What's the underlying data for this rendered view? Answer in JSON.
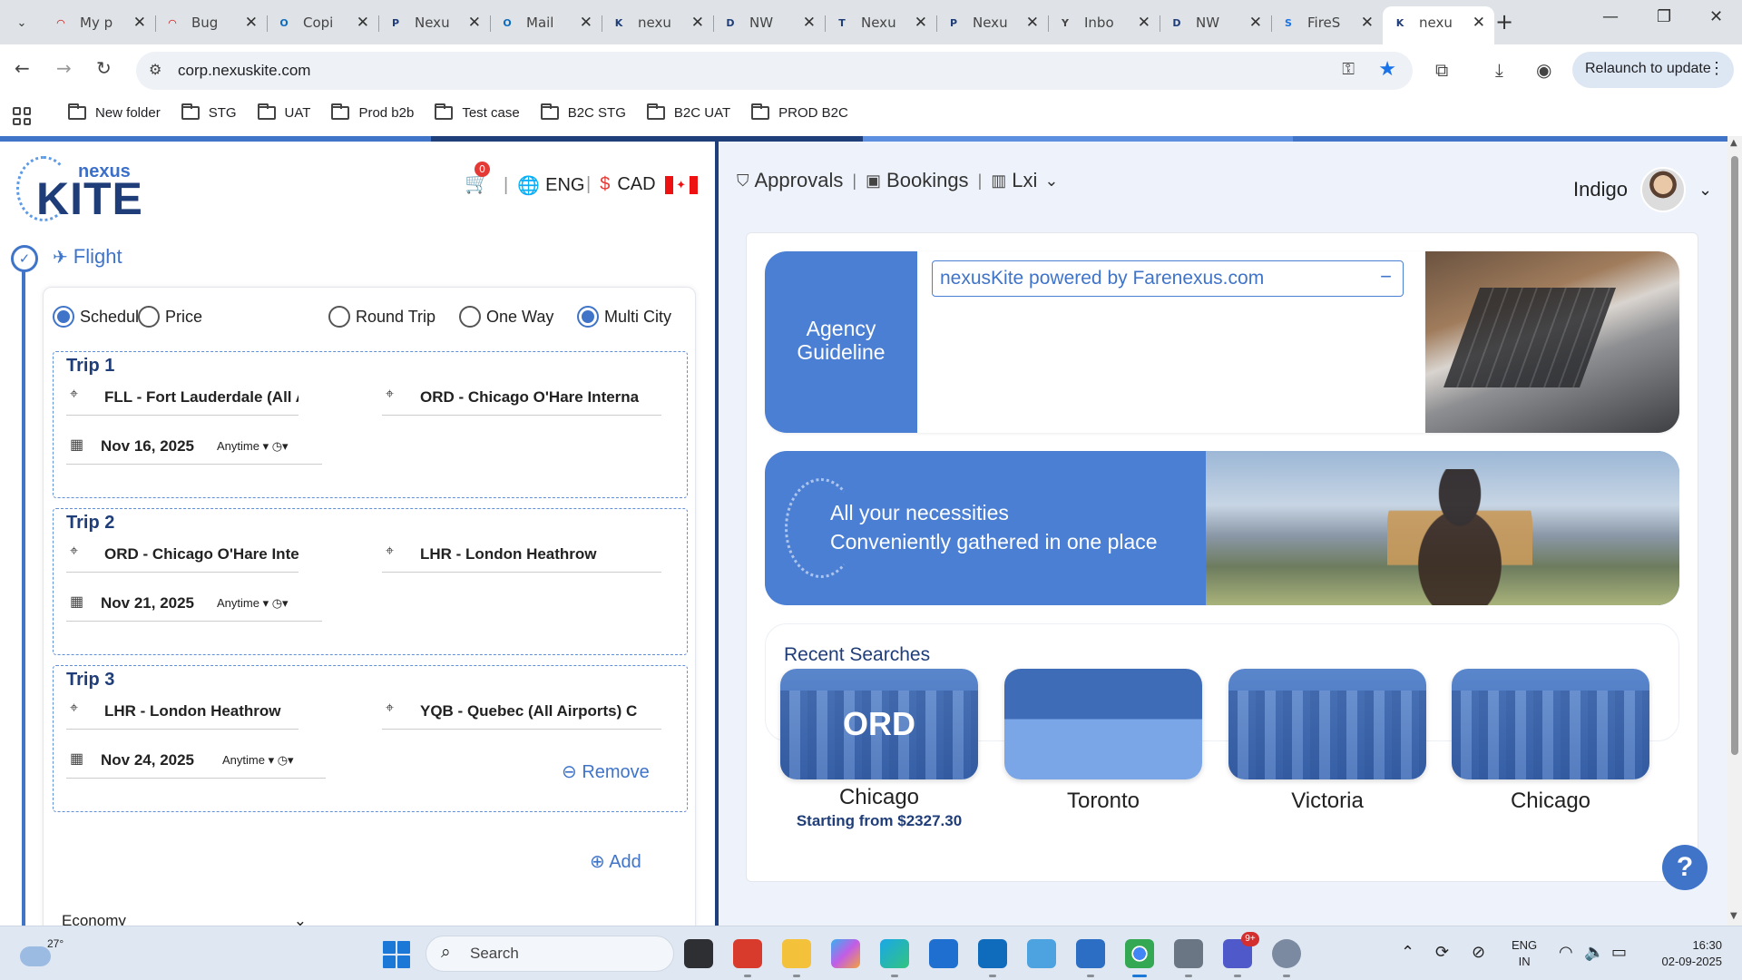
{
  "browser": {
    "tabs": [
      {
        "title": "My p",
        "icon": "redhat-icon",
        "color": "#cc0000",
        "glyph": "◠"
      },
      {
        "title": "Bug",
        "icon": "redhat-icon",
        "color": "#cc0000",
        "glyph": "◠"
      },
      {
        "title": "Copi",
        "icon": "outlook-icon",
        "color": "#0f6cbd",
        "glyph": "O"
      },
      {
        "title": "Nexu",
        "icon": "p-icon",
        "color": "#1f3d78",
        "glyph": "P"
      },
      {
        "title": "Mail",
        "icon": "outlook-icon",
        "color": "#0f6cbd",
        "glyph": "O"
      },
      {
        "title": "nexu",
        "icon": "k-icon",
        "color": "#1f3d78",
        "glyph": "K"
      },
      {
        "title": "NW",
        "icon": "d-icon",
        "color": "#1f3d78",
        "glyph": "D"
      },
      {
        "title": "Nexu",
        "icon": "t-icon",
        "color": "#1f3d78",
        "glyph": "T"
      },
      {
        "title": "Nexu",
        "icon": "p-icon",
        "color": "#1f3d78",
        "glyph": "P"
      },
      {
        "title": "Inbo",
        "icon": "yahoo-icon",
        "color": "#444444",
        "glyph": "Y"
      },
      {
        "title": "NW",
        "icon": "d-icon",
        "color": "#1f3d78",
        "glyph": "D"
      },
      {
        "title": "FireS",
        "icon": "fires-icon",
        "color": "#1a73e8",
        "glyph": "S"
      },
      {
        "title": "nexu",
        "icon": "k-icon",
        "color": "#1f3d78",
        "glyph": "K",
        "active": true
      }
    ],
    "url": "corp.nexuskite.com",
    "relaunch": "Relaunch to update",
    "bookmarks": [
      "New folder",
      "STG",
      "UAT",
      "Prod b2b",
      "Test case",
      "B2C STG",
      "B2C UAT",
      "PROD B2C"
    ]
  },
  "header": {
    "logo_top": "nexus",
    "logo_main": "KITE",
    "cart_count": "0",
    "language": "ENG",
    "currency": "CAD",
    "currency_symbol": "$"
  },
  "search": {
    "section": "Flight",
    "mode_options": [
      "Schedule",
      "Price"
    ],
    "mode_selected": "Schedule",
    "trip_types": [
      "Round Trip",
      "One Way",
      "Multi City"
    ],
    "trip_type_selected": "Multi City",
    "trips": [
      {
        "title": "Trip 1",
        "from": "FLL - Fort Lauderdale (All Airp",
        "to": "ORD - Chicago O'Hare Interna",
        "date": "Nov 16, 2025",
        "time": "Anytime"
      },
      {
        "title": "Trip 2",
        "from": "ORD - Chicago O'Hare Interna",
        "to": "LHR - London Heathrow",
        "date": "Nov 21, 2025",
        "time": "Anytime"
      },
      {
        "title": "Trip 3",
        "from": "LHR - London Heathrow",
        "to": "YQB - Quebec (All Airports) C",
        "date": "Nov 24, 2025",
        "time": "Anytime"
      }
    ],
    "remove_label": "Remove",
    "add_label": "Add",
    "cabin": "Economy"
  },
  "right_panel": {
    "nav": [
      "Approvals",
      "Bookings",
      "Lxi"
    ],
    "user": "Indigo",
    "agency_label": "Agency Guideline",
    "agency_banner": "nexusKite powered by Farenexus.com",
    "promo_line1": "All your necessities",
    "promo_line2": "Conveniently gathered in one place",
    "recent_title": "Recent Searches",
    "recent": [
      {
        "code": "ORD",
        "city": "Chicago",
        "price": "Starting from $2327.30"
      },
      {
        "code": "",
        "city": "Toronto",
        "price": ""
      },
      {
        "code": "",
        "city": "Victoria",
        "price": ""
      },
      {
        "code": "",
        "city": "Chicago",
        "price": ""
      }
    ],
    "help": "?"
  },
  "taskbar": {
    "temperature": "27°",
    "search": "Search",
    "lang1": "ENG",
    "lang2": "IN",
    "time": "16:30",
    "date": "02-09-2025",
    "teams_badge": "9+"
  },
  "colors": {
    "brand": "#3f74c9",
    "brand_dark": "#1f3d78",
    "panel_bg": "#eef3fb"
  }
}
